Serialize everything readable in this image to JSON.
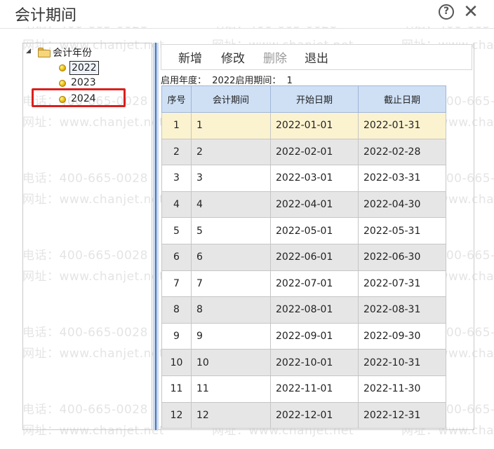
{
  "dialog": {
    "title": "会计期间",
    "help_glyph": "?",
    "close_glyph": "✕"
  },
  "watermark": {
    "phone": "电话：400-665-0028",
    "site": "网址：www.chanjet.net"
  },
  "tree": {
    "toggle_glyph": "◢",
    "root_label": "会计年份",
    "items": [
      {
        "label": "2022",
        "selected": true
      },
      {
        "label": "2023",
        "selected": false
      },
      {
        "label": "2024",
        "selected": false
      }
    ]
  },
  "toolbar": {
    "add_label": "新增",
    "edit_label": "修改",
    "delete_label": "删除",
    "exit_label": "退出"
  },
  "info": {
    "year_label": "启用年度：",
    "year_value": "2022",
    "period_label": "启用期间：",
    "period_value": "1"
  },
  "table": {
    "headers": [
      "序号",
      "会计期间",
      "开始日期",
      "截止日期"
    ],
    "rows": [
      [
        "1",
        "1",
        "2022-01-01",
        "2022-01-31"
      ],
      [
        "2",
        "2",
        "2022-02-01",
        "2022-02-28"
      ],
      [
        "3",
        "3",
        "2022-03-01",
        "2022-03-31"
      ],
      [
        "4",
        "4",
        "2022-04-01",
        "2022-04-30"
      ],
      [
        "5",
        "5",
        "2022-05-01",
        "2022-05-31"
      ],
      [
        "6",
        "6",
        "2022-06-01",
        "2022-06-30"
      ],
      [
        "7",
        "7",
        "2022-07-01",
        "2022-07-31"
      ],
      [
        "8",
        "8",
        "2022-08-01",
        "2022-08-31"
      ],
      [
        "9",
        "9",
        "2022-09-01",
        "2022-09-30"
      ],
      [
        "10",
        "10",
        "2022-10-01",
        "2022-10-31"
      ],
      [
        "11",
        "11",
        "2022-11-01",
        "2022-11-30"
      ],
      [
        "12",
        "12",
        "2022-12-01",
        "2022-12-31"
      ]
    ]
  }
}
